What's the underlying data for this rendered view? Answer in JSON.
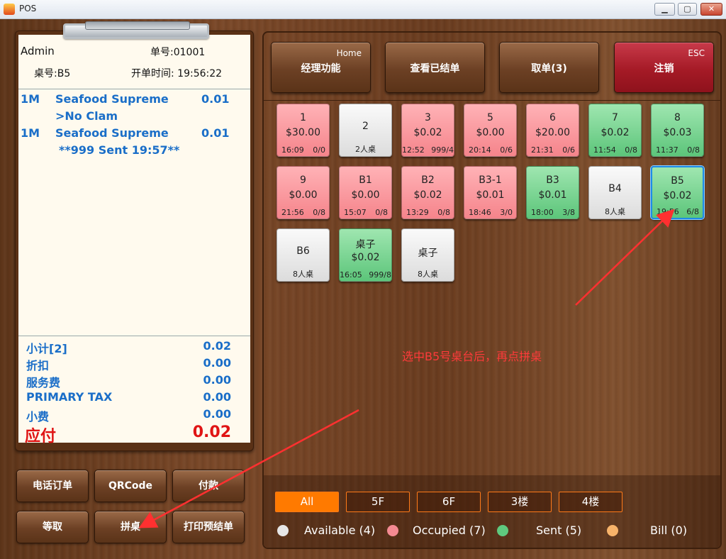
{
  "window": {
    "title": "POS",
    "minimize": "▁",
    "maximize": "▢",
    "close": "✕"
  },
  "ticket": {
    "user": "Admin",
    "order_no": "单号:01001",
    "table": "桌号:B5",
    "open_time": "开单时间: 19:56:22",
    "items": [
      {
        "qty": "1M",
        "name": "Seafood Supreme",
        "price": "0.01"
      },
      {
        "modifier": ">No Clam"
      },
      {
        "qty": "1M",
        "name": "Seafood Supreme",
        "price": "0.01"
      },
      {
        "note": "**999 Sent 19:57**"
      }
    ],
    "summary": [
      {
        "label": "小计[2]",
        "value": "0.02"
      },
      {
        "label": "折扣",
        "value": "0.00"
      },
      {
        "label": "服务费",
        "value": "0.00"
      },
      {
        "label": "PRIMARY TAX",
        "value": "0.00"
      },
      {
        "label": "小费",
        "value": "0.00"
      }
    ],
    "amount_due_label": "应付",
    "amount_due": "0.02"
  },
  "left_buttons": [
    "电话订单",
    "QRCode",
    "付款",
    "等取",
    "拼桌",
    "打印预结单"
  ],
  "top_buttons": [
    {
      "label": "经理功能",
      "hint": "Home"
    },
    {
      "label": "查看已结单",
      "hint": ""
    },
    {
      "label": "取单(3)",
      "hint": ""
    },
    {
      "label": "注销",
      "hint": "ESC"
    }
  ],
  "tables": [
    {
      "name": "1",
      "amount": "$30.00",
      "time": "16:09",
      "seats": "0/0",
      "status": "occupied"
    },
    {
      "name": "2",
      "amount": "",
      "capacity": "2人桌",
      "status": "available"
    },
    {
      "name": "3",
      "amount": "$0.02",
      "time": "12:52",
      "seats": "999/4",
      "status": "occupied"
    },
    {
      "name": "5",
      "amount": "$0.00",
      "time": "20:14",
      "seats": "0/6",
      "status": "occupied"
    },
    {
      "name": "6",
      "amount": "$20.00",
      "time": "21:31",
      "seats": "0/6",
      "status": "occupied"
    },
    {
      "name": "7",
      "amount": "$0.02",
      "time": "11:54",
      "seats": "0/8",
      "status": "sent"
    },
    {
      "name": "8",
      "amount": "$0.03",
      "time": "11:37",
      "seats": "0/8",
      "status": "sent"
    },
    {
      "name": "9",
      "amount": "$0.00",
      "time": "21:56",
      "seats": "0/8",
      "status": "occupied"
    },
    {
      "name": "B1",
      "amount": "$0.00",
      "time": "15:07",
      "seats": "0/8",
      "status": "occupied"
    },
    {
      "name": "B2",
      "amount": "$0.02",
      "time": "13:29",
      "seats": "0/8",
      "status": "occupied"
    },
    {
      "name": "B3-1",
      "amount": "$0.01",
      "time": "18:46",
      "seats": "3/0",
      "status": "occupied"
    },
    {
      "name": "B3",
      "amount": "$0.01",
      "time": "18:00",
      "seats": "3/8",
      "status": "sent"
    },
    {
      "name": "B4",
      "amount": "",
      "capacity": "8人桌",
      "status": "available"
    },
    {
      "name": "B5",
      "amount": "$0.02",
      "time": "19:56",
      "seats": "6/8",
      "status": "sent",
      "selected": true
    },
    {
      "name": "B6",
      "amount": "",
      "capacity": "8人桌",
      "status": "available"
    },
    {
      "name": "桌子",
      "amount": "$0.02",
      "time": "16:05",
      "seats": "999/8",
      "status": "sent"
    },
    {
      "name": "桌子",
      "amount": "",
      "capacity": "8人桌",
      "status": "available"
    }
  ],
  "annotation": "选中B5号桌台后，再点拼桌",
  "floors": [
    "All",
    "5F",
    "6F",
    "3楼",
    "4楼"
  ],
  "active_floor": "All",
  "legend": [
    {
      "label": "Available (4)",
      "color": "#e6e6e6"
    },
    {
      "label": "Occupied (7)",
      "color": "#f48a92"
    },
    {
      "label": "Sent (5)",
      "color": "#5fc97e"
    },
    {
      "label": "Bill (0)",
      "color": "#f7b36a"
    }
  ],
  "colors": {
    "accent": "#ff7a00",
    "annotation": "#ff3a3a",
    "ticket_text": "#1a6ec8",
    "due": "#e01414"
  }
}
